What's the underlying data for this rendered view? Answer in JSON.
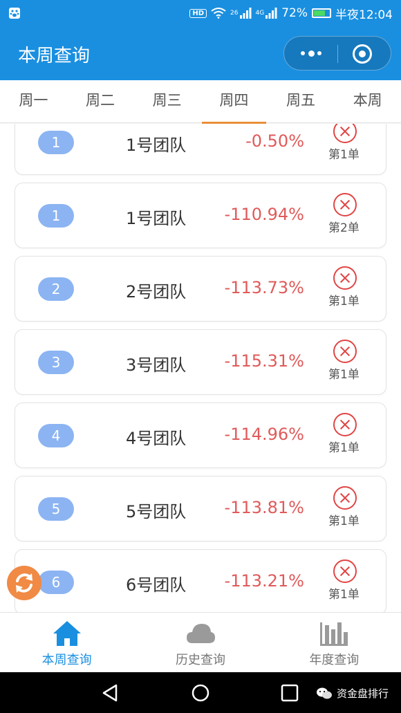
{
  "status_bar": {
    "network_badge": "HD",
    "net_speed_label": "26",
    "net_type_label": "4G",
    "battery_percent": "72%",
    "battery_level": 0.72,
    "time": "半夜12:04"
  },
  "header": {
    "title": "本周查询"
  },
  "tabs": [
    {
      "label": "周一",
      "active": false
    },
    {
      "label": "周二",
      "active": false
    },
    {
      "label": "周三",
      "active": false
    },
    {
      "label": "周四",
      "active": true
    },
    {
      "label": "周五",
      "active": false
    },
    {
      "label": "本周",
      "active": false
    }
  ],
  "records": [
    {
      "rank": "1",
      "team": "1号团队",
      "percent": "-0.50%",
      "order": "第1单"
    },
    {
      "rank": "1",
      "team": "1号团队",
      "percent": "-110.94%",
      "order": "第2单"
    },
    {
      "rank": "2",
      "team": "2号团队",
      "percent": "-113.73%",
      "order": "第1单"
    },
    {
      "rank": "3",
      "team": "3号团队",
      "percent": "-115.31%",
      "order": "第1单"
    },
    {
      "rank": "4",
      "team": "4号团队",
      "percent": "-114.96%",
      "order": "第1单"
    },
    {
      "rank": "5",
      "team": "5号团队",
      "percent": "-113.81%",
      "order": "第1单"
    },
    {
      "rank": "6",
      "team": "6号团队",
      "percent": "-113.21%",
      "order": "第1单"
    }
  ],
  "bottom_tabs": [
    {
      "label": "本周查询",
      "icon": "home-icon",
      "active": true
    },
    {
      "label": "历史查询",
      "icon": "cloud-icon",
      "active": false
    },
    {
      "label": "年度查询",
      "icon": "bar-chart-icon",
      "active": false
    }
  ],
  "watermark": {
    "text": "资金盘排行"
  },
  "colors": {
    "primary": "#1a8fe0",
    "tab_indicator": "#e89038",
    "rank_badge": "#8cb4f2",
    "negative": "#e05a5a",
    "refresh_button": "#f08a45"
  }
}
